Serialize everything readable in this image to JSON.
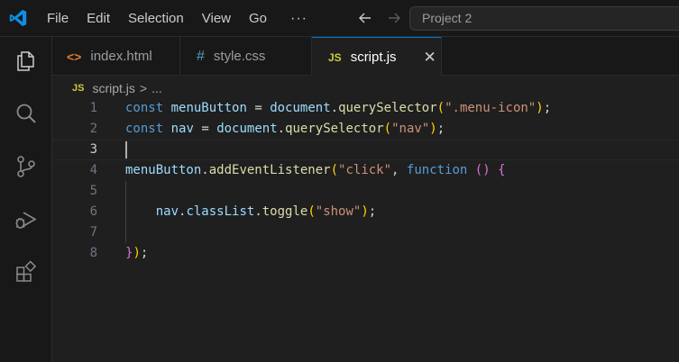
{
  "titlebar": {
    "menu": [
      "File",
      "Edit",
      "Selection",
      "View",
      "Go"
    ],
    "more": "···",
    "search_text": "Project 2"
  },
  "activity_icons": [
    "explorer-icon",
    "search-icon",
    "source-control-icon",
    "run-debug-icon",
    "extensions-icon"
  ],
  "tabs": [
    {
      "icon": "<>",
      "label": "index.html"
    },
    {
      "icon": "#",
      "label": "style.css"
    },
    {
      "icon": "JS",
      "label": "script.js",
      "close": "✕"
    }
  ],
  "breadcrumb": {
    "icon": "JS",
    "file": "script.js",
    "sep": ">",
    "rest": "..."
  },
  "editor": {
    "line_numbers": [
      "1",
      "2",
      "3",
      "4",
      "5",
      "6",
      "7",
      "8"
    ],
    "current_line": 3
  },
  "code": {
    "l1": [
      "const",
      "menuButton",
      "=",
      "document",
      ".",
      "querySelector",
      "(",
      "\".menu-icon\"",
      ")",
      ";"
    ],
    "l2": [
      "const",
      "nav",
      "=",
      "document",
      ".",
      "querySelector",
      "(",
      "\"nav\"",
      ")",
      ";"
    ],
    "l4": [
      "menuButton",
      ".",
      "addEventListener",
      "(",
      "\"click\"",
      ",",
      "function",
      "()",
      "{"
    ],
    "l6": [
      "nav",
      ".",
      "classList",
      ".",
      "toggle",
      "(",
      "\"show\"",
      ")",
      ";"
    ],
    "l8": [
      "}",
      ")",
      ";"
    ]
  },
  "colors": {
    "accent": "#0078d4",
    "keyword": "#569cd6",
    "variable": "#9cdcfe",
    "function": "#dcdcaa",
    "string": "#ce9178",
    "bracket1": "#ffd700",
    "bracket2": "#da70d6",
    "js_icon": "#cbcb41",
    "html_icon": "#e37933",
    "css_icon": "#519aba"
  }
}
